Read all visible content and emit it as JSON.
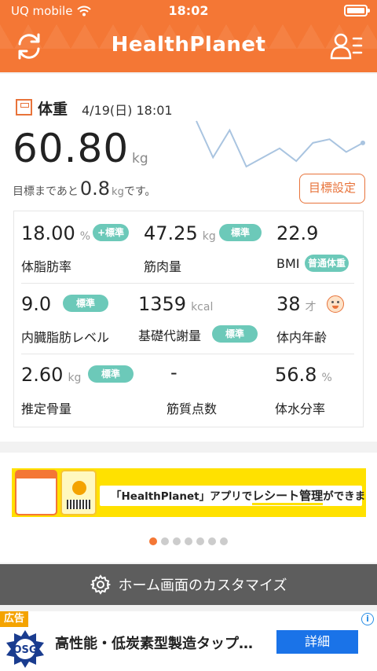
{
  "status_bar": {
    "carrier": "UQ mobile",
    "time": "18:02"
  },
  "header": {
    "title": "HealthPlanet"
  },
  "weight": {
    "title": "体重",
    "date": "4/19(日) 18:01",
    "value": "60.80",
    "unit": "kg",
    "goal_prefix": "目標まであと",
    "goal_value": "0.8",
    "goal_unit": "kg",
    "goal_suffix": "です。",
    "goal_button": "目標設定",
    "trend": [
      62,
      60,
      61.5,
      59.5,
      60,
      60.5,
      59.8,
      60.8,
      61,
      60.3,
      60.8
    ]
  },
  "metrics": {
    "body_fat": {
      "value": "18.00",
      "unit": "%",
      "badge": "+標準",
      "label": "体脂肪率"
    },
    "muscle": {
      "value": "47.25",
      "unit": "kg",
      "badge": "標準",
      "label": "筋肉量"
    },
    "bmi": {
      "value": "22.9",
      "badge": "普通体重",
      "label": "BMI"
    },
    "visceral": {
      "value": "9.0",
      "badge": "標準",
      "label": "内臓脂肪レベル"
    },
    "bmr": {
      "value": "1359",
      "unit": "kcal",
      "badge": "標準",
      "label": "基礎代謝量"
    },
    "body_age": {
      "value": "38",
      "unit": "才",
      "label": "体内年齢"
    },
    "bone": {
      "value": "2.60",
      "unit": "kg",
      "badge": "標準",
      "label": "推定骨量"
    },
    "muscle_quality": {
      "value": "-",
      "label": "筋質点数"
    },
    "water": {
      "value": "56.8",
      "unit": "%",
      "label": "体水分率"
    }
  },
  "banner": {
    "text_prefix": "「HealthPlanet」アプリで",
    "text_highlight": "レシート管理",
    "text_suffix": "ができます!",
    "pages": 7,
    "active_page": 0
  },
  "customize": {
    "label": "ホーム画面のカスタマイズ"
  },
  "ad": {
    "tag": "広告",
    "text": "高性能・低炭素型製造タップ…",
    "button": "詳細",
    "logo_text": "OSG"
  },
  "colors": {
    "brand": "#f47735",
    "badge": "#6cc9b9",
    "ad_button": "#1a73e8"
  }
}
